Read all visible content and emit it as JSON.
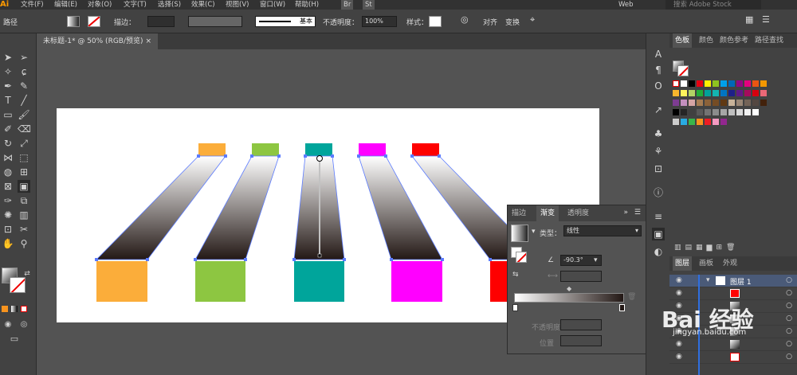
{
  "app": {
    "logo": "Ai"
  },
  "menu": {
    "items": [
      "文件(F)",
      "编辑(E)",
      "对象(O)",
      "文字(T)",
      "选择(S)",
      "效果(C)",
      "视图(V)",
      "窗口(W)",
      "帮助(H)"
    ],
    "right_buttons": [
      "Br",
      "St"
    ],
    "workspace": "Web",
    "search_placeholder": "搜索 Adobe Stock"
  },
  "control": {
    "selection_label": "路径",
    "stroke_label": "描边：",
    "stroke_style": "基本",
    "opacity_label": "不透明度：",
    "opacity_value": "100%",
    "style_label": "样式：",
    "align_label": "对齐",
    "transform_label": "变换"
  },
  "document": {
    "tab_title": "未标题-1* @ 50% (RGB/预览)",
    "close": "×"
  },
  "colors": {
    "orange": "#fbad3a",
    "green": "#8dc641",
    "teal": "#00a59b",
    "magenta": "#ff00ff",
    "red": "#fe0000",
    "ui_bg": "#535353"
  },
  "swatch_panel": {
    "tabs": [
      "色板",
      "颜色",
      "颜色参考",
      "路径查找"
    ]
  },
  "gradient_panel": {
    "tabs": [
      "描边",
      "渐变",
      "透明度"
    ],
    "type_label": "类型：",
    "type_value": "线性",
    "angle_value": "-90.3°",
    "opacity_label": "不透明度",
    "location_label": "位置"
  },
  "layers_panel": {
    "tabs": [
      "图层",
      "画板",
      "外观"
    ],
    "layer_name": "图层 1"
  },
  "watermark": {
    "text": "Bai 经验",
    "url": "jingyan.baidu.com"
  }
}
